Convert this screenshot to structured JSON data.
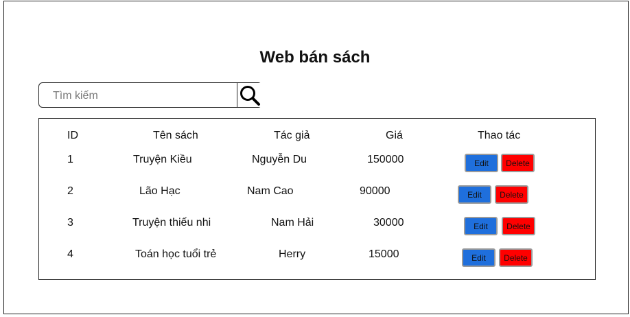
{
  "page": {
    "title": "Web bán sách"
  },
  "search": {
    "placeholder": "Tìm kiếm",
    "value": "",
    "icon": "search-icon"
  },
  "table": {
    "headers": [
      "ID",
      "Tên sách",
      "Tác giả",
      "Giá",
      "Thao tác"
    ],
    "rows": [
      {
        "id": "1",
        "title": "Truyện Kiều",
        "author": "Nguyễn Du",
        "price": "150000",
        "edit_label": "Edit",
        "delete_label": "Delete"
      },
      {
        "id": "2",
        "title": "Lão Hạc",
        "author": "Nam Cao",
        "price": "90000",
        "edit_label": "Edit",
        "delete_label": "Delete"
      },
      {
        "id": "3",
        "title": "Truyện thiếu nhi",
        "author": "Nam Hải",
        "price": "30000",
        "edit_label": "Edit",
        "delete_label": "Delete"
      },
      {
        "id": "4",
        "title": "Toán học tuổi trẻ",
        "author": "Herry",
        "price": "15000",
        "edit_label": "Edit",
        "delete_label": "Delete"
      }
    ]
  },
  "colors": {
    "edit": "#1f6fdc",
    "delete": "#ff0000"
  }
}
